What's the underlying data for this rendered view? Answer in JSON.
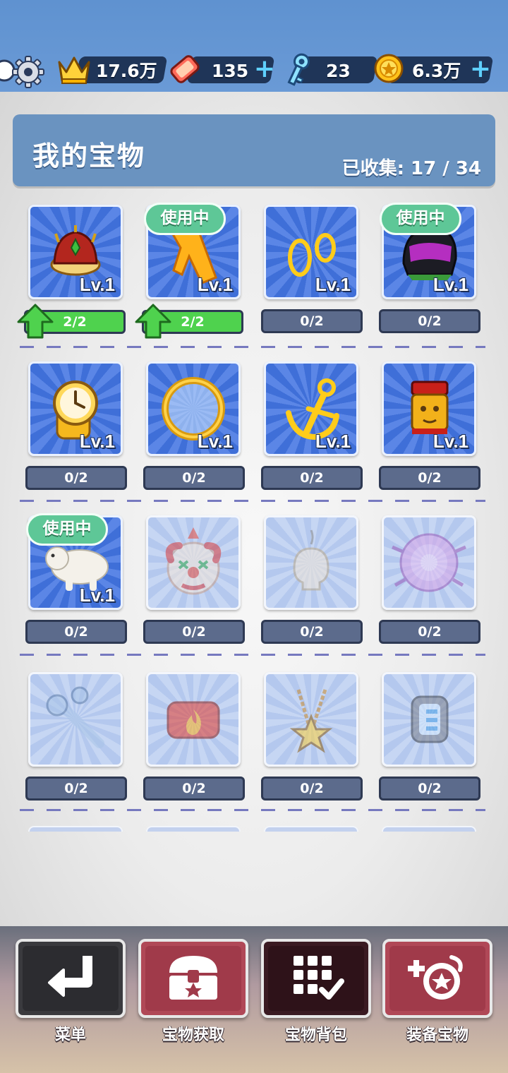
{
  "hud": {
    "crowns": "17.6万",
    "tickets": "135",
    "keys": "23",
    "coins": "6.3万",
    "plus": "+"
  },
  "header": {
    "title": "我的宝物",
    "collected": "已收集: 17 / 34"
  },
  "treasures": [
    {
      "icon": "crown-icon",
      "level": "Lv.1",
      "in_use": "",
      "progress": "2/2",
      "upgradable": true
    },
    {
      "icon": "scarf-icon",
      "level": "Lv.1",
      "in_use": "使用中",
      "progress": "2/2",
      "upgradable": true
    },
    {
      "icon": "earrings-icon",
      "level": "Lv.1",
      "in_use": "",
      "progress": "0/2",
      "upgradable": false
    },
    {
      "icon": "helmet-icon",
      "level": "Lv.1",
      "in_use": "使用中",
      "progress": "0/2",
      "upgradable": false
    },
    {
      "icon": "watch-icon",
      "level": "Lv.1",
      "in_use": "",
      "progress": "0/2",
      "upgradable": false
    },
    {
      "icon": "ring-icon",
      "level": "Lv.1",
      "in_use": "",
      "progress": "0/2",
      "upgradable": false
    },
    {
      "icon": "anchor-icon",
      "level": "Lv.1",
      "in_use": "",
      "progress": "0/2",
      "upgradable": false
    },
    {
      "icon": "lion-drum-icon",
      "level": "Lv.1",
      "in_use": "",
      "progress": "0/2",
      "upgradable": false
    },
    {
      "icon": "polar-bear-icon",
      "level": "Lv.1",
      "in_use": "使用中",
      "progress": "0/2",
      "upgradable": false
    },
    {
      "icon": "clown-mask-icon",
      "level": "",
      "in_use": "",
      "progress": "0/2",
      "upgradable": false
    },
    {
      "icon": "skull-necklace-icon",
      "level": "",
      "in_use": "",
      "progress": "0/2",
      "upgradable": false
    },
    {
      "icon": "flower-icon",
      "level": "",
      "in_use": "",
      "progress": "0/2",
      "upgradable": false
    },
    {
      "icon": "wrench-icon",
      "level": "",
      "in_use": "",
      "progress": "0/2",
      "upgradable": false
    },
    {
      "icon": "fire-badge-icon",
      "level": "",
      "in_use": "",
      "progress": "0/2",
      "upgradable": false
    },
    {
      "icon": "star-necklace-icon",
      "level": "",
      "in_use": "",
      "progress": "0/2",
      "upgradable": false
    },
    {
      "icon": "smartwatch-icon",
      "level": "",
      "in_use": "",
      "progress": "0/2",
      "upgradable": false
    }
  ],
  "nav": {
    "menu": "菜单",
    "obtain": "宝物获取",
    "backpack": "宝物背包",
    "equip": "装备宝物"
  },
  "colors": {
    "topbar": "#6a9ad6",
    "header": "#6a93c0",
    "in_use_badge": "#5ec797",
    "progress_full": "#4fd24e",
    "progress_empty": "#5c6b8c",
    "nav_red": "#a03a4a",
    "nav_dark": "#2c2c30"
  }
}
